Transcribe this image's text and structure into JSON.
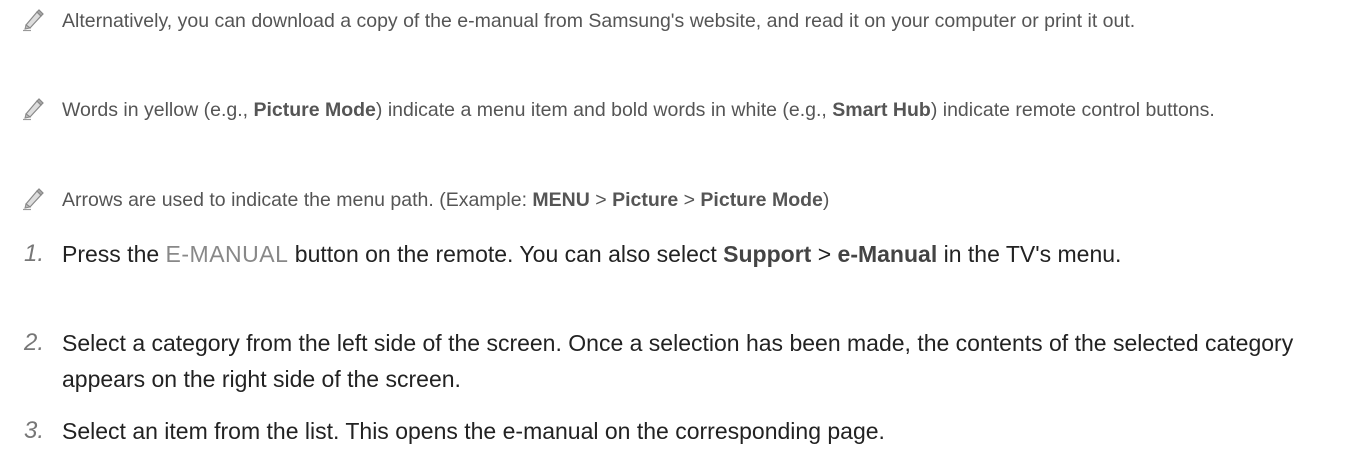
{
  "notes": [
    {
      "icon": "pencil-icon",
      "text": "Alternatively, you can download a copy of the e-manual from Samsung's website, and read it on your computer or print it out."
    },
    {
      "icon": "pencil-icon",
      "part1": "Words in yellow (e.g., ",
      "bold1": "Picture Mode",
      "part2": ") indicate a menu item and bold words in white (e.g., ",
      "bold2": "Smart Hub",
      "part3": ") indicate remote control buttons."
    },
    {
      "icon": "pencil-icon",
      "part1": "Arrows are used to indicate the menu path. (Example: ",
      "bold1": "MENU",
      "sep1": " > ",
      "bold2": "Picture",
      "sep2": " > ",
      "bold3": "Picture Mode",
      "part2": ")"
    }
  ],
  "steps": [
    {
      "number": "1.",
      "part1": "Press the ",
      "button": "E-MANUAL",
      "part2": " button on the remote. You can also select ",
      "bold1": "Support",
      "sep": " > ",
      "bold2": "e-Manual",
      "part3": " in the TV's menu."
    },
    {
      "number": "2.",
      "text": "Select a category from the left side of the screen. Once a selection has been made, the contents of the selected category appears on the right side of the screen."
    },
    {
      "number": "3.",
      "text": "Select an item from the list. This opens the e-manual on the corresponding page."
    }
  ],
  "colors": {
    "note_text": "#555555",
    "step_text": "#222222",
    "step_number": "#777777"
  }
}
